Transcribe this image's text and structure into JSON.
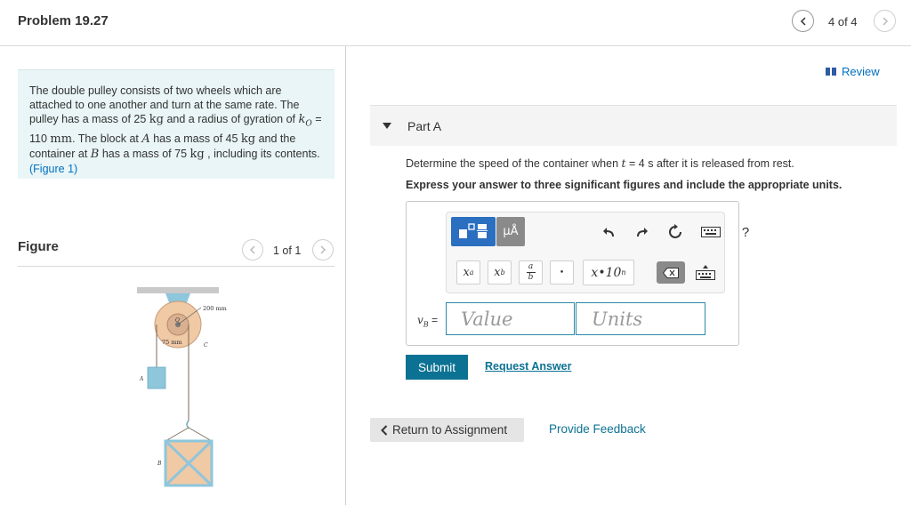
{
  "header": {
    "title": "Problem 19.27",
    "pager": "4 of 4"
  },
  "problem": {
    "t1": "The double pulley consists of two wheels which are attached to one another and turn at the same rate. The pulley has a mass of 25 ",
    "u_kg1": "kg",
    "t2": " and a radius of gyration of ",
    "k_sym": "k",
    "k_sub": "O",
    "t3": " = 110 ",
    "u_mm": "mm",
    "t4": ". The block at ",
    "sym_A": "A",
    "t5": " has a mass of 45 ",
    "u_kg2": "kg",
    "t6": " and the container at ",
    "sym_B": "B",
    "t7": " has a mass of 75 ",
    "u_kg3": "kg",
    "t8": " , including its contents. ",
    "figure_link": "(Figure 1)"
  },
  "figure": {
    "title": "Figure",
    "pager": "1 of 1",
    "labels": {
      "outer_radius": "200 mm",
      "inner_radius": "75 mm",
      "point_O": "O",
      "point_C": "C",
      "point_A": "A",
      "point_B": "B"
    }
  },
  "review": "Review",
  "part": {
    "label": "Part A",
    "q1": "Determine the speed of the container when ",
    "q_var": "t",
    "q2": " = 4  s after it is released from rest.",
    "instruction": "Express your answer to three significant figures and include the appropriate units."
  },
  "answer": {
    "toolbar": {
      "units_btn": "μÅ",
      "superscript_base": "x",
      "superscript_exp": "a",
      "subscript_base": "x",
      "subscript_sub": "b",
      "frac_num": "a",
      "frac_den": "b",
      "dot": "•",
      "sci_base": "x",
      "sci_mid": "•10",
      "sci_exp": "n",
      "help": "?"
    },
    "var_symbol": "v",
    "var_sub": "B",
    "var_eq": " =",
    "value_placeholder": "Value",
    "units_placeholder": "Units"
  },
  "actions": {
    "submit": "Submit",
    "request": "Request Answer",
    "return": "Return to Assignment",
    "feedback": "Provide Feedback"
  },
  "colors": {
    "accent": "#0c7294",
    "link": "#0070c0",
    "problem_bg": "#e9f5f7"
  }
}
